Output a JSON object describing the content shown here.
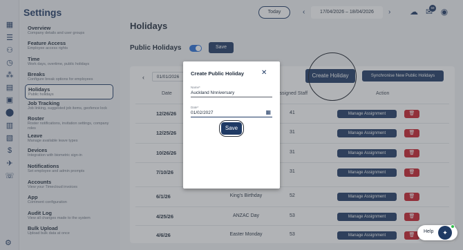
{
  "settings": {
    "title": "Settings",
    "items": [
      {
        "name": "Overview",
        "desc": "Company details and user groups"
      },
      {
        "name": "Feature Access",
        "desc": "Employee access rights"
      },
      {
        "name": "Time",
        "desc": "Work days, overtime, public holidays"
      },
      {
        "name": "Breaks",
        "desc": "Configure break options for employees"
      },
      {
        "name": "Holidays",
        "desc": "Public holidays"
      },
      {
        "name": "Job Tracking",
        "desc": "Job linking, suggested job items, geofence lock"
      },
      {
        "name": "Roster",
        "desc": "Roster notifications, invitation settings, company roles"
      },
      {
        "name": "Leave",
        "desc": "Manage available leave types"
      },
      {
        "name": "Devices",
        "desc": "Integration with biometric sign-in"
      },
      {
        "name": "Notifications",
        "desc": "Set employee and admin prompts"
      },
      {
        "name": "Accounts",
        "desc": "View your Timecloud invoices"
      },
      {
        "name": "App",
        "desc": "Comment configuration"
      },
      {
        "name": "Audit Log",
        "desc": "View all changes made to the system"
      },
      {
        "name": "Bulk Upload",
        "desc": "Upload bulk data at once"
      }
    ]
  },
  "topbar": {
    "today": "Today",
    "date_from": "17/04/2026",
    "date_sep": "–",
    "date_to": "18/04/2026",
    "mail_badge": "59"
  },
  "page": {
    "title": "Holidays",
    "public_holidays_label": "Public Holidays",
    "public_holidays_enabled": true,
    "save_label": "Save"
  },
  "table": {
    "from_date": "01/01/2026",
    "create_label": "Create Holiday",
    "sync_label": "Synchronise New Public Holidays",
    "headers": {
      "date": "Date",
      "assigned": "Assigned Staff",
      "action": "Action"
    },
    "assign_label": "Manage Assignment",
    "rows": [
      {
        "date": "12/26/26",
        "name": "",
        "staff": "41"
      },
      {
        "date": "12/25/26",
        "name": "",
        "staff": "31"
      },
      {
        "date": "10/26/26",
        "name": "",
        "staff": "31"
      },
      {
        "date": "7/10/26",
        "name": "",
        "staff": "31"
      },
      {
        "date": "6/1/26",
        "name": "King's Birthday",
        "staff": "52"
      },
      {
        "date": "4/25/26",
        "name": "ANZAC Day",
        "staff": "53"
      },
      {
        "date": "4/6/26",
        "name": "Easter Monday",
        "staff": "53"
      }
    ]
  },
  "modal": {
    "title": "Create Public Holiday",
    "name_label": "Name*",
    "name_value": "Auckland Nnniversary",
    "date_label": "Date*",
    "date_value": "01/02/2027",
    "save_label": "Save"
  },
  "help": {
    "label": "Help"
  },
  "colors": {
    "brand": "#1f3a64",
    "danger": "#c81e2a",
    "toggle": "#2a6fd6"
  }
}
